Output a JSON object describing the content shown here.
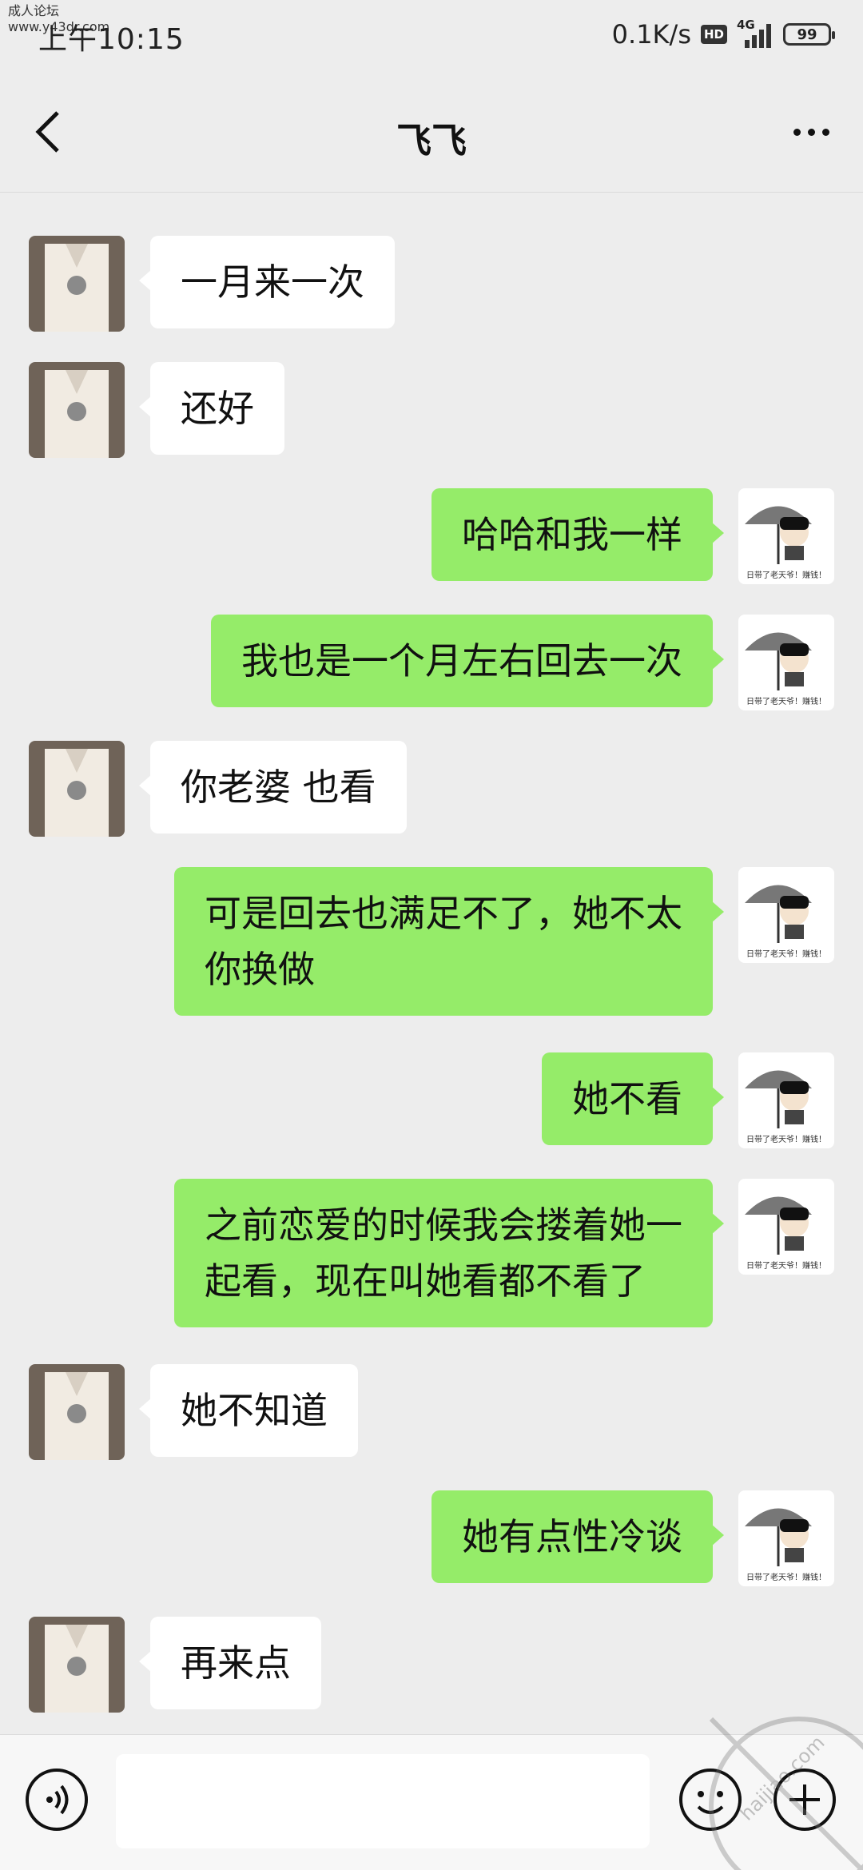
{
  "status_bar": {
    "time": "上午10:15",
    "watermark_line1": "成人论坛",
    "watermark_line2": "www.y43dr.com",
    "net_speed": "0.1K/s",
    "hd": "HD",
    "network": "4G",
    "battery": "99"
  },
  "nav": {
    "title": "飞飞"
  },
  "messages": [
    {
      "side": "in",
      "text": "一月来一次"
    },
    {
      "side": "in",
      "text": "还好"
    },
    {
      "side": "out",
      "text": "哈哈和我一样"
    },
    {
      "side": "out",
      "text": "我也是一个月左右回去一次"
    },
    {
      "side": "in",
      "text": "你老婆 也看"
    },
    {
      "side": "out",
      "text_line1": "可是回去也满足不了，她不太",
      "text_line2": "你换做"
    },
    {
      "side": "out",
      "text": "她不看"
    },
    {
      "side": "out",
      "text_line1": "之前恋爱的时候我会搂着她一",
      "text_line2": "起看，现在叫她看都不看了"
    },
    {
      "side": "in",
      "text": "她不知道"
    },
    {
      "side": "out",
      "text": "她有点性冷谈"
    },
    {
      "side": "in",
      "text": "再来点"
    }
  ],
  "my_avatar_caption": "日带了老天爷！赚钱！",
  "input_bar": {
    "value": "",
    "corner_watermark": "haijiao.com"
  },
  "colors": {
    "background": "#ededed",
    "bubble_out": "#95ec69",
    "bubble_in": "#ffffff"
  }
}
